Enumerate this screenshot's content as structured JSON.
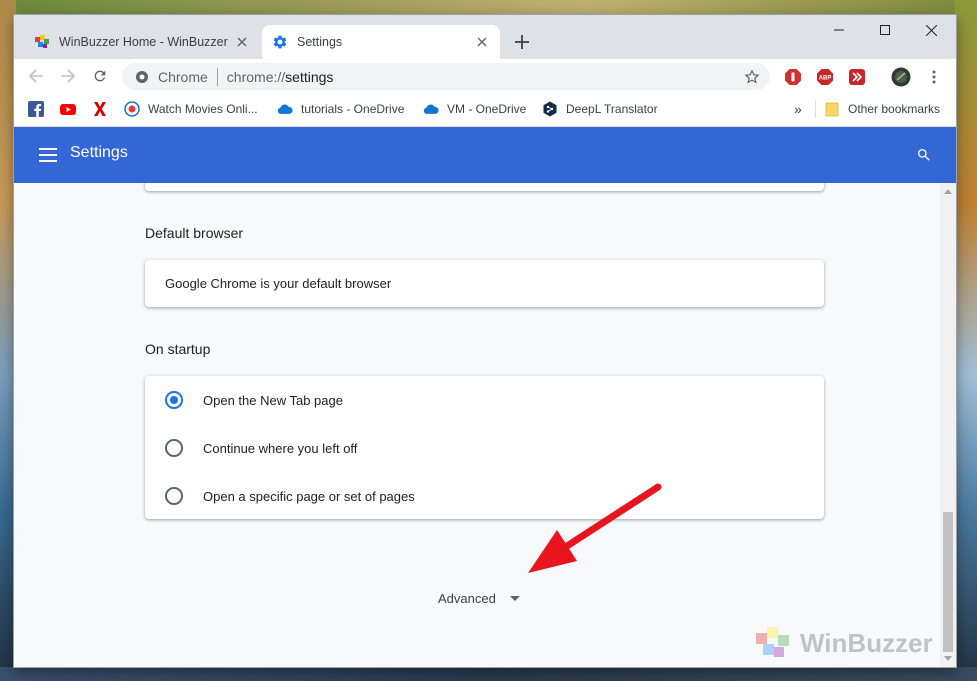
{
  "tabs": [
    {
      "title": "WinBuzzer Home - WinBuzzer",
      "icon": "winbuzzer-favicon"
    },
    {
      "title": "Settings",
      "icon": "gear-icon"
    }
  ],
  "omnibox": {
    "chip": "Chrome",
    "url_prefix": "chrome://",
    "url_path": "settings"
  },
  "bookmarks": [
    {
      "label": "",
      "icon": "facebook-icon"
    },
    {
      "label": "",
      "icon": "youtube-icon"
    },
    {
      "label": "",
      "icon": "x-icon"
    },
    {
      "label": "Watch Movies Onli...",
      "icon": "movies-icon"
    },
    {
      "label": "tutorials - OneDrive",
      "icon": "onedrive-icon"
    },
    {
      "label": "VM - OneDrive",
      "icon": "onedrive-icon"
    },
    {
      "label": "DeepL Translator",
      "icon": "deepl-icon"
    }
  ],
  "bookmarks_overflow": "»",
  "other_bookmarks": "Other bookmarks",
  "header": {
    "title": "Settings"
  },
  "default_browser": {
    "section_title": "Default browser",
    "status_text": "Google Chrome is your default browser"
  },
  "on_startup": {
    "section_title": "On startup",
    "options": [
      {
        "label": "Open the New Tab page",
        "selected": true
      },
      {
        "label": "Continue where you left off",
        "selected": false
      },
      {
        "label": "Open a specific page or set of pages",
        "selected": false
      }
    ]
  },
  "advanced": {
    "label": "Advanced"
  },
  "watermark": "WinBuzzer",
  "colors": {
    "header_blue": "#3367d6",
    "radio_blue": "#1a73e8",
    "arrow_red": "#e8141e"
  }
}
